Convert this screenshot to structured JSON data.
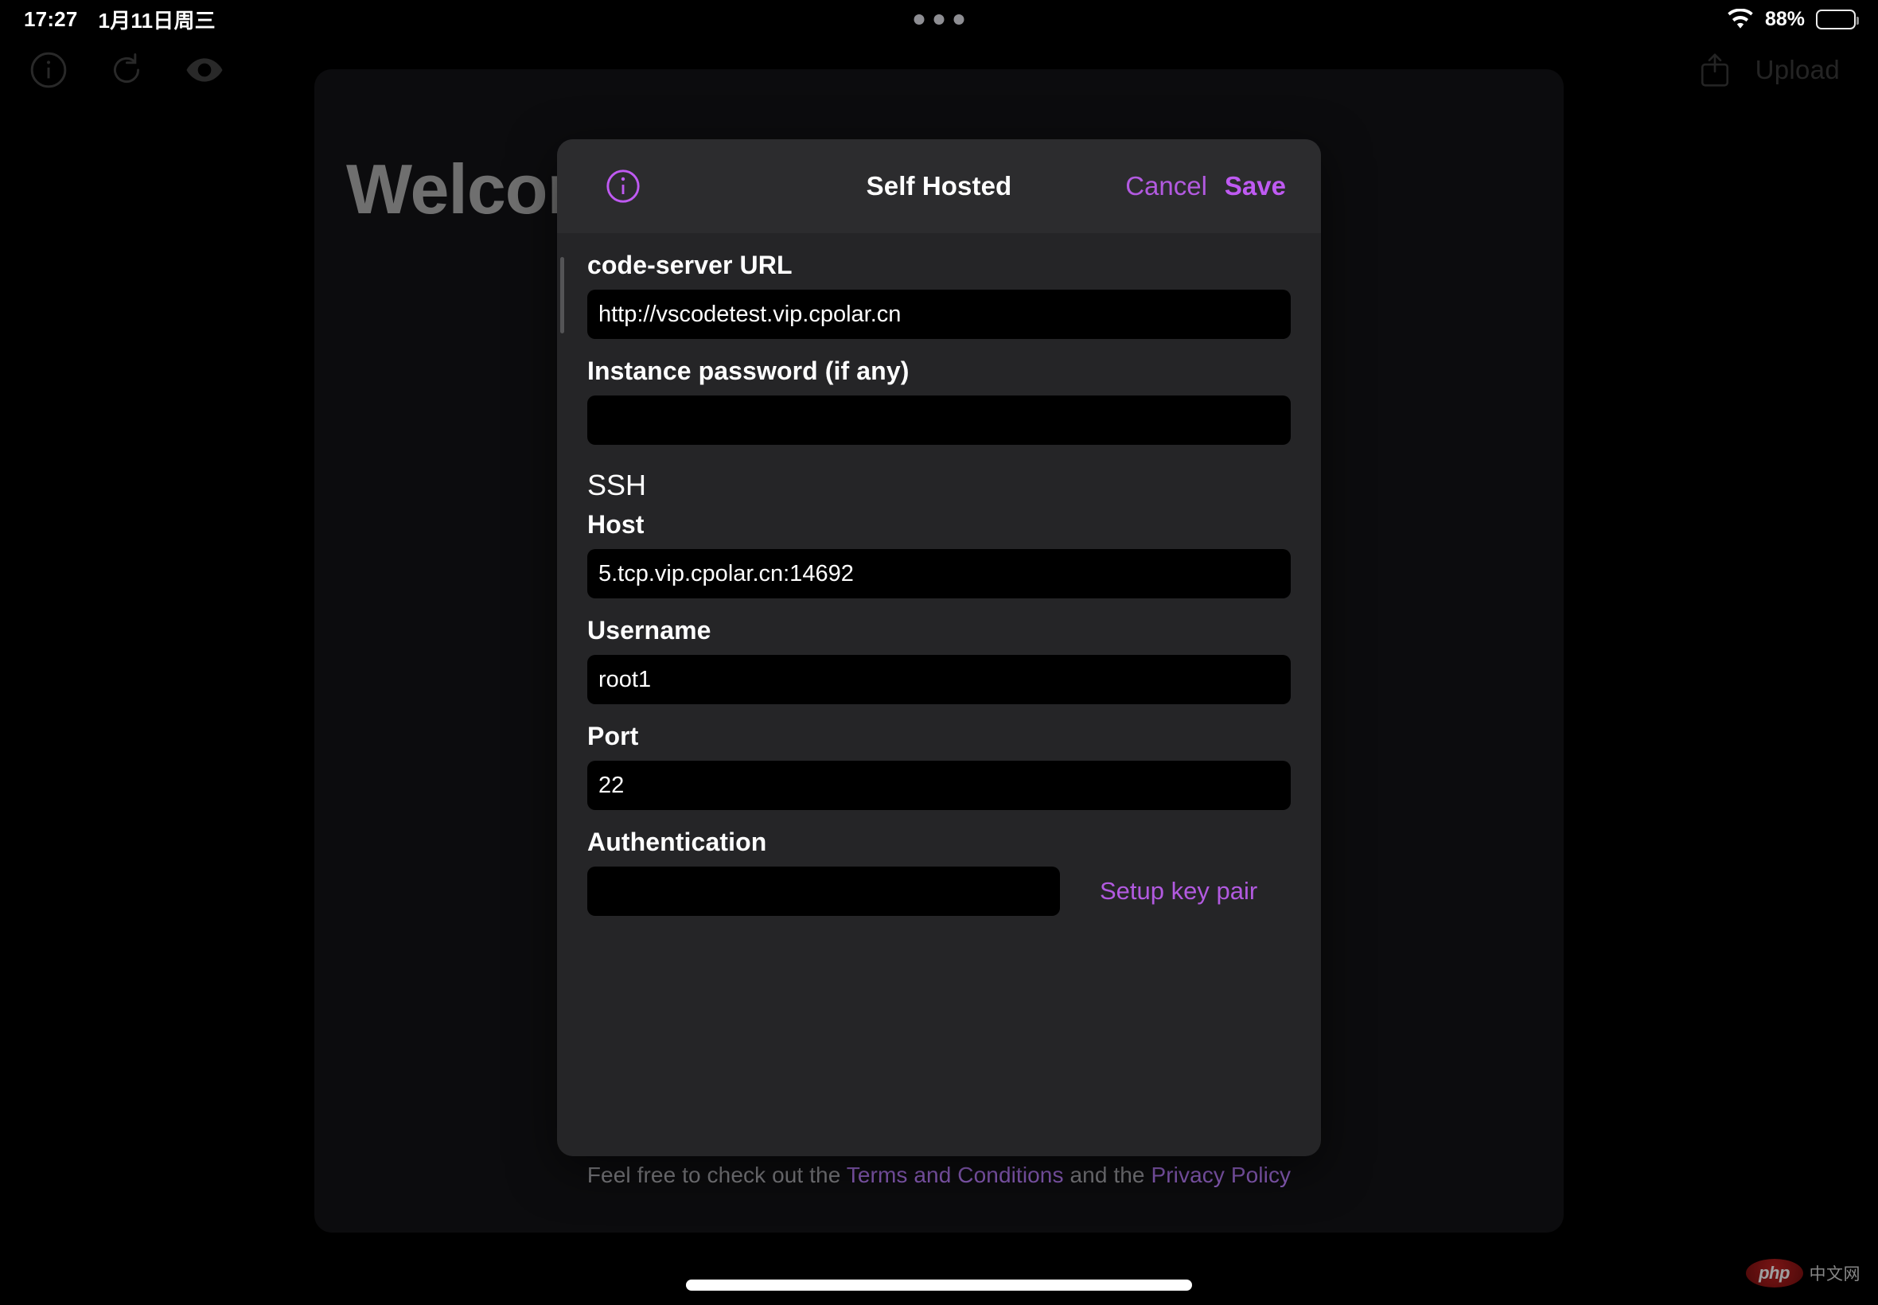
{
  "status_bar": {
    "time": "17:27",
    "date": "1月11日周三",
    "battery_percent": "88%",
    "wifi_icon": "wifi-icon",
    "battery_icon": "battery-icon",
    "multitask_dots": "multitask-dots-icon"
  },
  "backdrop": {
    "toolbar": {
      "info_icon": "info-circle-icon",
      "reload_icon": "reload-icon",
      "eye_icon": "eye-icon",
      "upload_icon": "upload-icon",
      "upload_label": "Upload"
    },
    "welcome_title": "Welcome",
    "legal": {
      "prefix": "Feel free to check out the ",
      "terms_link": "Terms and Conditions",
      "middle": " and the ",
      "privacy_link": "Privacy Policy"
    }
  },
  "modal": {
    "info_icon": "info-circle-icon",
    "title": "Self Hosted",
    "cancel_label": "Cancel",
    "save_label": "Save",
    "fields": {
      "code_server_url": {
        "label": "code-server URL",
        "value": "http://vscodetest.vip.cpolar.cn",
        "placeholder": ""
      },
      "instance_password": {
        "label": "Instance password (if any)",
        "value": "",
        "placeholder": ""
      },
      "ssh_section": "SSH",
      "host": {
        "label": "Host",
        "value": "5.tcp.vip.cpolar.cn:14692",
        "placeholder": ""
      },
      "username": {
        "label": "Username",
        "value": "root1",
        "placeholder": ""
      },
      "port": {
        "label": "Port",
        "value": "22",
        "placeholder": ""
      },
      "authentication": {
        "label": "Authentication",
        "value": "",
        "placeholder": "",
        "setup_key_label": "Setup key pair"
      }
    }
  },
  "watermark": {
    "badge": "php",
    "text": "中文网"
  },
  "colors": {
    "accent_purple": "#bf5af2",
    "accent_purple_muted": "#b25ae0",
    "modal_bg": "#252527",
    "modal_header_bg": "#2c2c2e",
    "input_bg": "#000000",
    "page_bg": "#000000"
  }
}
